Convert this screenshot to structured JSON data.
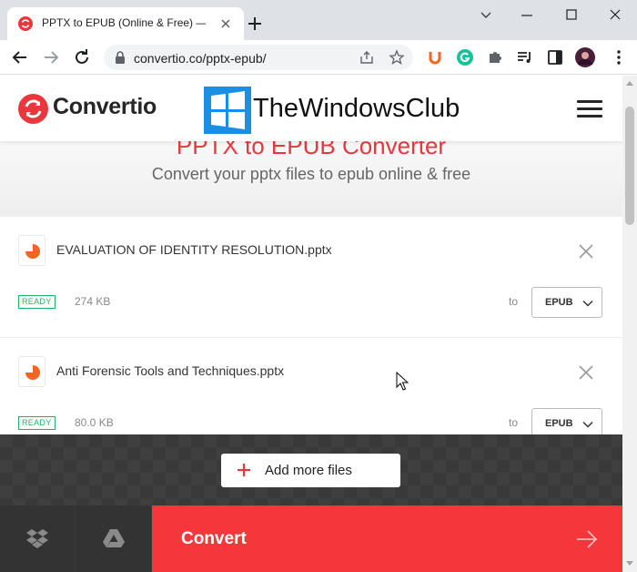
{
  "browser": {
    "tab_title": "PPTX to EPUB (Online & Free) —",
    "url": "convertio.co/pptx-epub/"
  },
  "header": {
    "brand": "Convertio",
    "watermark": "TheWindowsClub"
  },
  "hero": {
    "title": "PPTX to EPUB Converter",
    "subtitle": "Convert your pptx files to epub online & free"
  },
  "files": [
    {
      "name": "EVALUATION OF IDENTITY RESOLUTION.pptx",
      "status": "READY",
      "size": "274 KB",
      "to_label": "to",
      "format": "EPUB"
    },
    {
      "name": "Anti Forensic Tools and Techniques.pptx",
      "status": "READY",
      "size": "80.0 KB",
      "to_label": "to",
      "format": "EPUB"
    }
  ],
  "actions": {
    "add_more": "Add more files",
    "convert": "Convert"
  },
  "colors": {
    "brand_red": "#e8383d",
    "convert_red": "#f5373c",
    "ready_green": "#27ae60",
    "dark_band": "#3f3f3f"
  },
  "icons": {
    "cloud_sources": [
      "dropbox-icon",
      "google-drive-icon"
    ],
    "extensions": [
      "u-extension-icon",
      "grammarly-icon",
      "puzzle-icon",
      "media-queue-icon",
      "side-panel-icon",
      "profile-avatar"
    ]
  }
}
